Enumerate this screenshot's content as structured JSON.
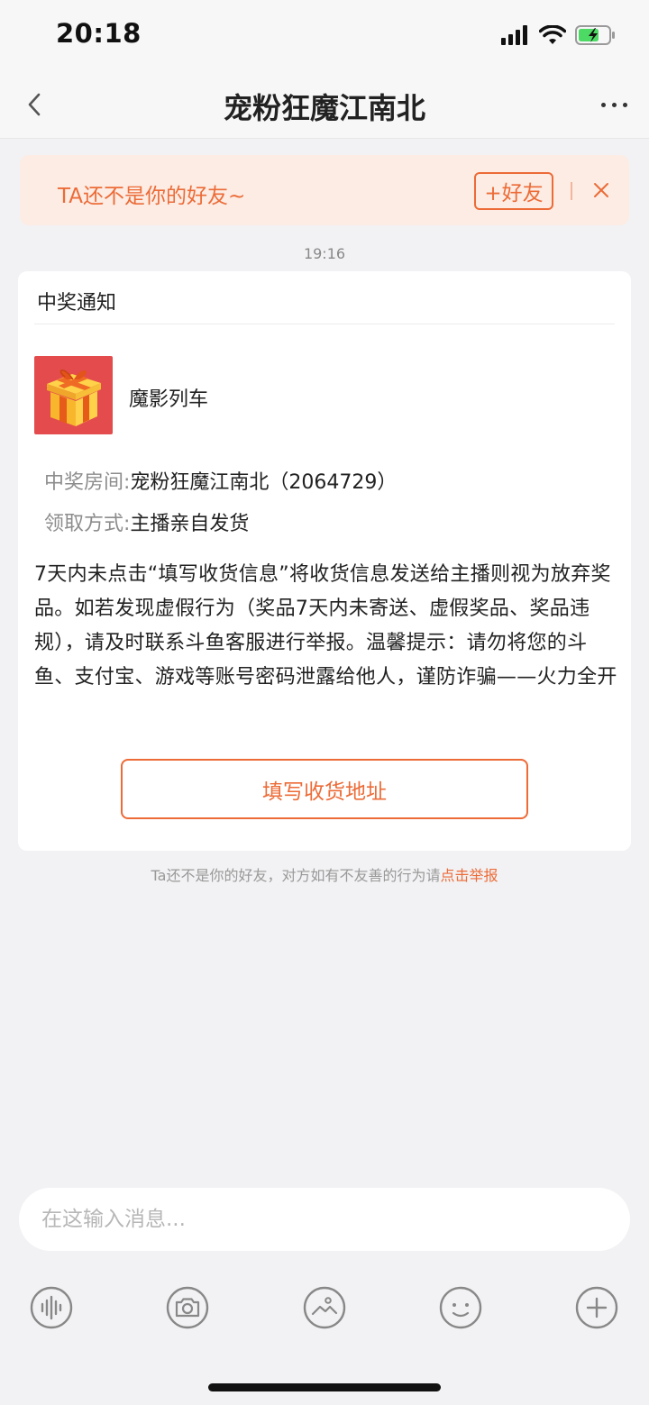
{
  "status_bar": {
    "time": "20:18"
  },
  "nav": {
    "title": "宠粉狂魔江南北"
  },
  "friend_banner": {
    "text": "TA还不是你的好友~",
    "add_button": "+好友"
  },
  "timestamp": "19:16",
  "card": {
    "title": "中奖通知",
    "prize_name": "魔影列车",
    "room_label": "中奖房间:",
    "room_value": "宠粉狂魔江南北（2064729）",
    "method_label": "领取方式:",
    "method_value": "主播亲自发货",
    "description": "7天内未点击“填写收货信息”将收货信息发送给主播则视为放弃奖品。如若发现虚假行为（奖品7天内未寄送、虚假奖品、奖品违规），请及时联系斗鱼客服进行举报。温馨提示：请勿将您的斗鱼、支付宝、游戏等账号密码泄露给他人，谨防诈骗——火力全开",
    "button": "填写收货地址"
  },
  "notice": {
    "text": "Ta还不是你的好友，对方如有不友善的行为请",
    "link": "点击举报"
  },
  "input": {
    "placeholder": "在这输入消息..."
  },
  "toolbar": {
    "icons": [
      "voice-icon",
      "camera-icon",
      "image-icon",
      "emoji-icon",
      "plus-icon"
    ]
  },
  "colors": {
    "accent": "#ec6b37",
    "banner_bg": "#fcece4",
    "page_bg": "#f2f2f4",
    "prize_bg": "#e34b4d"
  }
}
